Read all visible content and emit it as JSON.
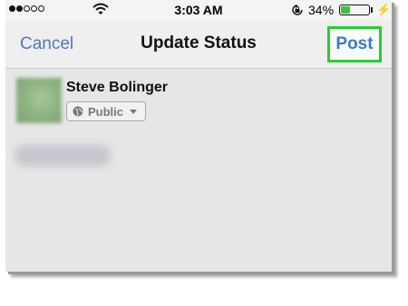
{
  "status_bar": {
    "time": "3:03 AM",
    "battery_percent": "34%",
    "battery_level": 0.34,
    "signal_bars_filled": 2,
    "signal_bars_total": 5,
    "icons": [
      "signal-icon",
      "wifi-icon",
      "rotation-lock-icon",
      "battery-icon",
      "charging-bolt-icon"
    ]
  },
  "nav": {
    "cancel_label": "Cancel",
    "title": "Update Status",
    "post_label": "Post",
    "post_highlight_color": "#25d02c",
    "accent_color": "#4a78c0"
  },
  "composer": {
    "user_name": "Steve Bolinger",
    "audience_label": "Public",
    "audience_icon": "globe-icon",
    "dropdown_icon": "caret-down-icon"
  }
}
